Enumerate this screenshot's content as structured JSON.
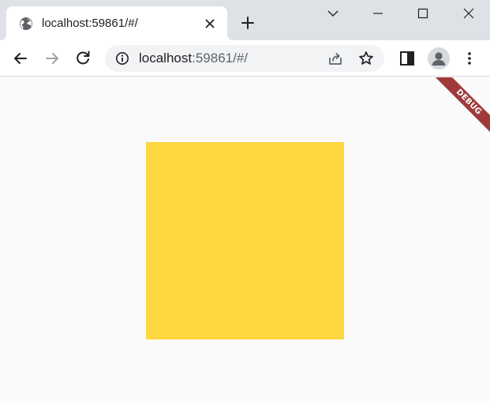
{
  "browser": {
    "tab": {
      "title": "localhost:59861/#/",
      "favicon": "globe-icon"
    },
    "omnibox": {
      "host": "localhost",
      "path": ":59861/#/"
    },
    "icons": {
      "back": "arrow-left-icon",
      "forward": "arrow-right-icon",
      "reload": "reload-icon",
      "site_info": "info-icon",
      "share": "share-icon",
      "bookmark": "star-icon",
      "side_panel": "side-panel-icon",
      "profile": "person-icon",
      "menu": "kebab-menu-icon"
    }
  },
  "app": {
    "box_color": "#ffd740",
    "debug_banner": "DEBUG",
    "debug_banner_color": "#a03a3a"
  },
  "colors": {
    "tabstrip": "#dee1e6",
    "page_background": "#fafafa"
  }
}
